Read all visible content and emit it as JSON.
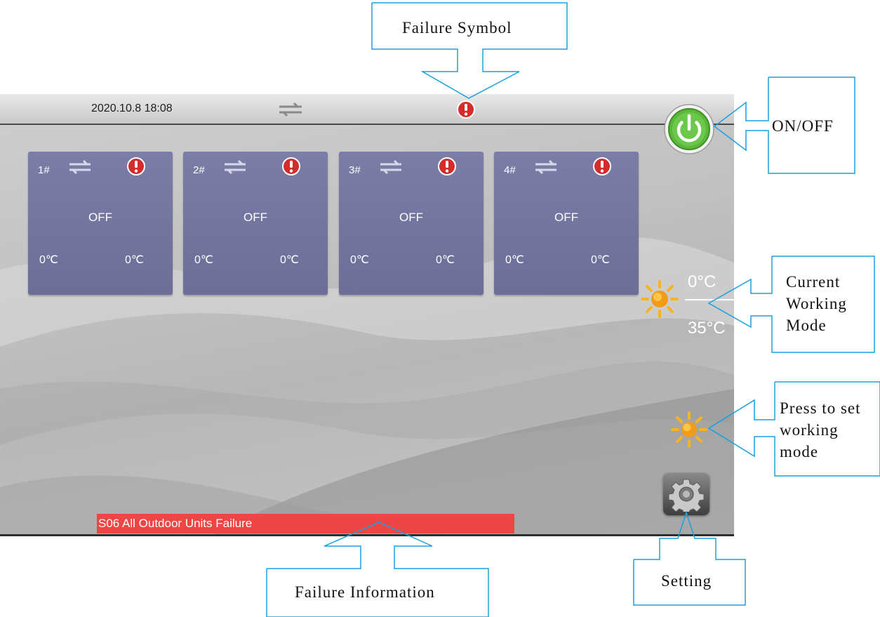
{
  "status_bar": {
    "datetime": "2020.10.8 18:08",
    "link_icon": "swap-arrows-icon",
    "failure_icon": "exclamation-alert-icon"
  },
  "units": [
    {
      "id": "1#",
      "status": "OFF",
      "temp_a": "0℃",
      "temp_b": "0℃"
    },
    {
      "id": "2#",
      "status": "OFF",
      "temp_a": "0℃",
      "temp_b": "0℃"
    },
    {
      "id": "3#",
      "status": "OFF",
      "temp_a": "0℃",
      "temp_b": "0℃"
    },
    {
      "id": "4#",
      "status": "OFF",
      "temp_a": "0℃",
      "temp_b": "0℃"
    }
  ],
  "mode_display": {
    "mode_icon": "sun-heating-icon",
    "temp_top": "0°C",
    "temp_bottom": "35°C"
  },
  "controls": {
    "power_icon": "power-icon",
    "mode_button_icon": "sun-icon",
    "settings_icon": "gear-icon"
  },
  "failure_message": "S06 All Outdoor Units Failure",
  "annotations": {
    "failure_symbol": "Failure Symbol",
    "on_off": "ON/OFF",
    "current_mode_lines": [
      "Current",
      "Working",
      "Mode"
    ],
    "set_mode_lines": [
      "Press to set",
      "working",
      "mode"
    ],
    "failure_info": "Failure Information",
    "setting": "Setting"
  },
  "colors": {
    "unit_card": "#7475a0",
    "failure_bar": "#ee4545",
    "alert_red": "#d42b2b",
    "power_green": "#5cb83c",
    "callout_blue": "#1aa0e0"
  }
}
